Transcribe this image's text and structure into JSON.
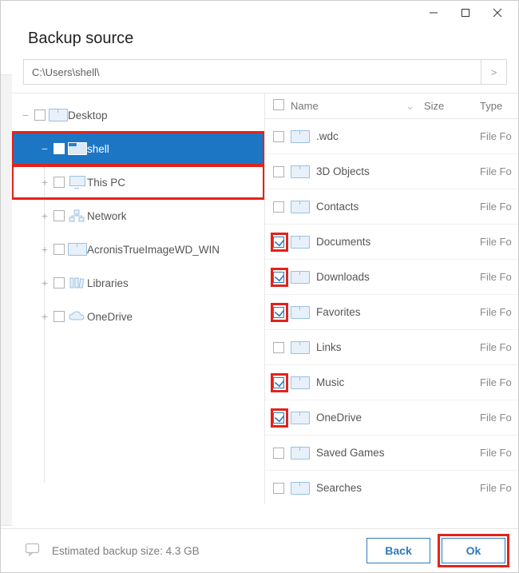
{
  "window": {
    "title": "Backup source"
  },
  "path": {
    "value": "C:\\Users\\shell\\",
    "go_label": ">"
  },
  "tree": {
    "items": [
      {
        "name": "Desktop",
        "icon": "folder",
        "expanded": true,
        "selected": false,
        "highlight": false,
        "indent": 0
      },
      {
        "name": "shell",
        "icon": "folder-open",
        "expanded": true,
        "selected": true,
        "highlight": true,
        "indent": 1
      },
      {
        "name": "This PC",
        "icon": "monitor",
        "expanded": false,
        "selected": false,
        "highlight": true,
        "indent": 1
      },
      {
        "name": "Network",
        "icon": "network",
        "expanded": false,
        "selected": false,
        "highlight": false,
        "indent": 1
      },
      {
        "name": "AcronisTrueImageWD_WIN",
        "icon": "folder",
        "expanded": false,
        "selected": false,
        "highlight": false,
        "indent": 1
      },
      {
        "name": "Libraries",
        "icon": "libraries",
        "expanded": false,
        "selected": false,
        "highlight": false,
        "indent": 1
      },
      {
        "name": "OneDrive",
        "icon": "cloud",
        "expanded": false,
        "selected": false,
        "highlight": false,
        "indent": 1
      }
    ]
  },
  "list": {
    "headers": {
      "name": "Name",
      "size": "Size",
      "type": "Type"
    },
    "rows": [
      {
        "name": ".wdc",
        "checked": false,
        "highlight": false,
        "type": "File Fo"
      },
      {
        "name": "3D Objects",
        "checked": false,
        "highlight": false,
        "type": "File Fo"
      },
      {
        "name": "Contacts",
        "checked": false,
        "highlight": false,
        "type": "File Fo"
      },
      {
        "name": "Documents",
        "checked": true,
        "highlight": true,
        "type": "File Fo"
      },
      {
        "name": "Downloads",
        "checked": true,
        "highlight": true,
        "type": "File Fo"
      },
      {
        "name": "Favorites",
        "checked": true,
        "highlight": true,
        "type": "File Fo"
      },
      {
        "name": "Links",
        "checked": false,
        "highlight": false,
        "type": "File Fo"
      },
      {
        "name": "Music",
        "checked": true,
        "highlight": true,
        "type": "File Fo"
      },
      {
        "name": "OneDrive",
        "checked": true,
        "highlight": true,
        "type": "File Fo"
      },
      {
        "name": "Saved Games",
        "checked": false,
        "highlight": false,
        "type": "File Fo"
      },
      {
        "name": "Searches",
        "checked": false,
        "highlight": false,
        "type": "File Fo"
      }
    ]
  },
  "footer": {
    "est_label": "Estimated backup size:",
    "est_value": "4.3 GB",
    "back": "Back",
    "ok": "Ok"
  }
}
